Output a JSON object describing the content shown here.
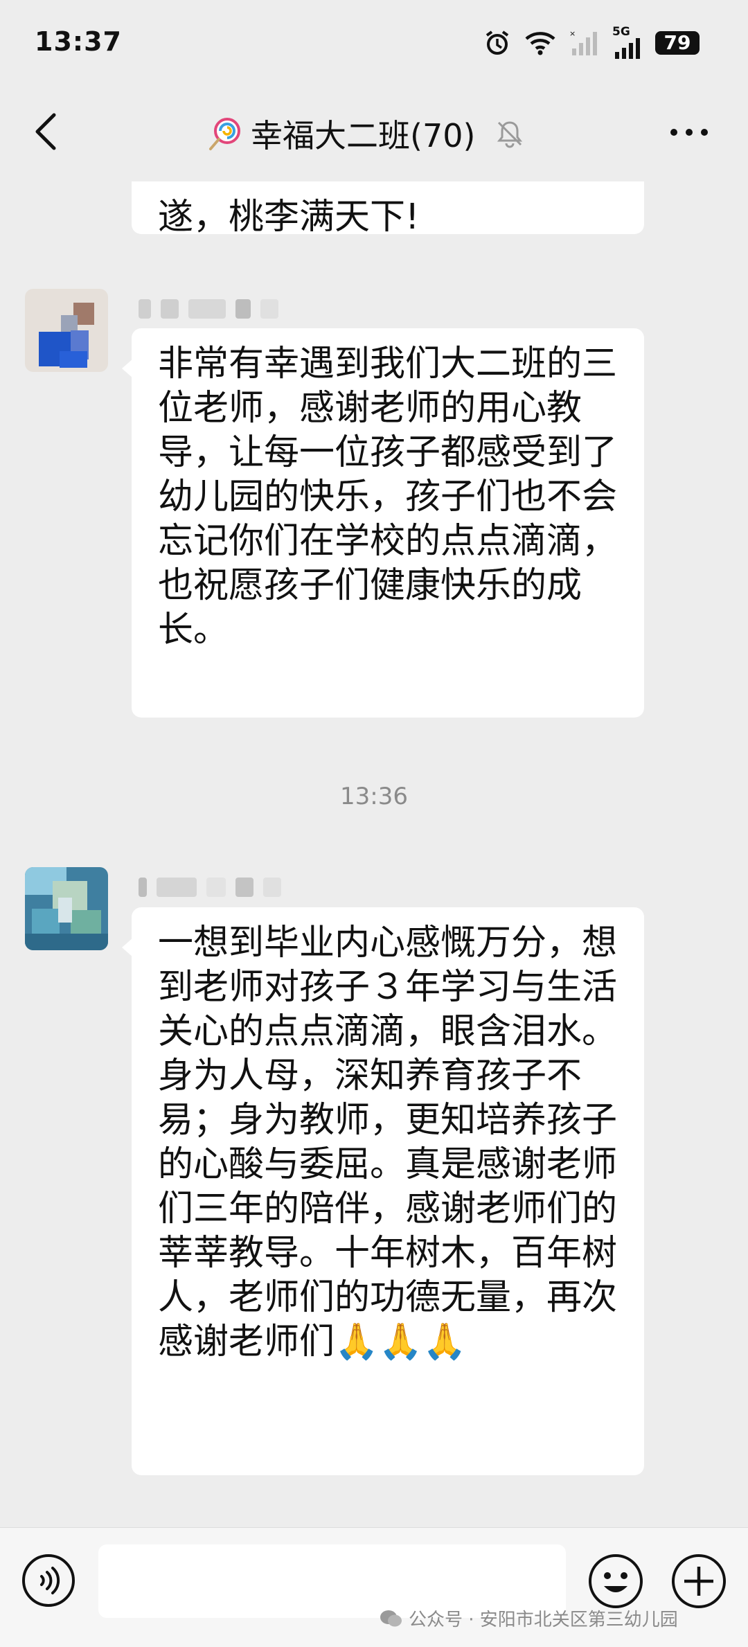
{
  "status_bar": {
    "time": "13:37",
    "network": "5G",
    "battery": "79"
  },
  "nav": {
    "title": "幸福大二班(70)",
    "title_emoji": "lollipop-icon",
    "mute_icon": "bell-off-icon",
    "more_icon": "more-dots-icon"
  },
  "messages": {
    "first_partial": {
      "visible_text": "遂，桃李满天下!"
    },
    "second": {
      "text": "非常有幸遇到我们大二班的三位老师，感谢老师的用心教导，让每一位孩子都感受到了幼儿园的快乐，孩子们也不会忘记你们在学校的点点滴滴，也祝愿孩子们健康快乐的成长。"
    },
    "timestamp": "13:36",
    "third": {
      "text": "一想到毕业内心感慨万分，想到老师对孩子３年学习与生活关心的点点滴滴，眼含泪水。身为人母，深知养育孩子不易；身为教师，更知培养孩子的心酸与委屈。真是感谢老师们三年的陪伴，感谢老师们的莘莘教导。十年树木，百年树人，老师们的功德无量，再次感谢老师们🙏🙏🙏"
    }
  },
  "input_bar": {
    "voice_icon": "voice-icon",
    "emoji_icon": "emoji-icon",
    "plus_icon": "plus-icon"
  },
  "watermark": {
    "text": "公众号 · 安阳市北关区第三幼儿园"
  },
  "colors": {
    "background": "#ededed",
    "bubble": "#ffffff",
    "text": "#111111",
    "muted": "#8a8a8a"
  }
}
